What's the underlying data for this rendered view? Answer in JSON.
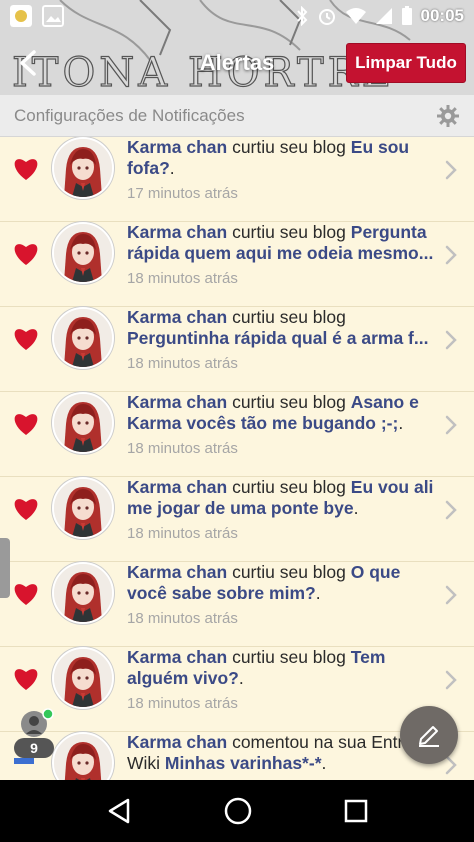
{
  "status_bar": {
    "time": "00:05"
  },
  "header": {
    "title": "Alertas",
    "clear_label": "Limpar Tudo"
  },
  "settings": {
    "label": "Configurações de Notificações"
  },
  "notifications": [
    {
      "user": "Karma chan",
      "action": "curtiu seu blog",
      "pre": "",
      "blog": "Eu sou fofa?",
      "suffix": ".",
      "time": "17 minutos atrás"
    },
    {
      "user": "Karma chan",
      "action": "curtiu seu blog",
      "pre": "",
      "blog": "Pergunta rápida quem aqui me odeia mesmo...",
      "suffix": "",
      "time": "18 minutos atrás"
    },
    {
      "user": "Karma chan",
      "action": "curtiu seu blog",
      "pre": "",
      "blog": "Perguntinha rápida qual é a arma f...",
      "suffix": "",
      "time": "18 minutos atrás"
    },
    {
      "user": "Karma chan",
      "action": "curtiu seu blog",
      "pre": "",
      "blog": "Asano e Karma vocês tão me bugando ;-;",
      "suffix": ".",
      "time": "18 minutos atrás"
    },
    {
      "user": "Karma chan",
      "action": "curtiu seu blog",
      "pre": "",
      "blog": "Eu vou ali me jogar de uma ponte bye",
      "suffix": ".",
      "time": "18 minutos atrás"
    },
    {
      "user": "Karma chan",
      "action": "curtiu seu blog",
      "pre": "",
      "blog": "O que você sabe sobre mim?",
      "suffix": ".",
      "time": "18 minutos atrás"
    },
    {
      "user": "Karma chan",
      "action": "curtiu seu blog",
      "pre": "",
      "blog": "Tem alguém vivo?",
      "suffix": ".",
      "time": "18 minutos atrás"
    },
    {
      "user": "Karma chan",
      "action": "comentou na sua",
      "pre": "Entrada Wiki",
      "blog": "Minhas varinhas*-*",
      "suffix": ".",
      "time": ""
    }
  ],
  "online_count": "9",
  "colors": {
    "accent": "#c41230",
    "link": "#3b4a86",
    "heart": "#d8142d",
    "background": "#fdf6de"
  },
  "icons": {
    "back": "back-arrow-icon",
    "settings": "gear-icon",
    "like": "heart-icon",
    "chevron": "chevron-right-icon",
    "compose": "pencil-icon"
  }
}
